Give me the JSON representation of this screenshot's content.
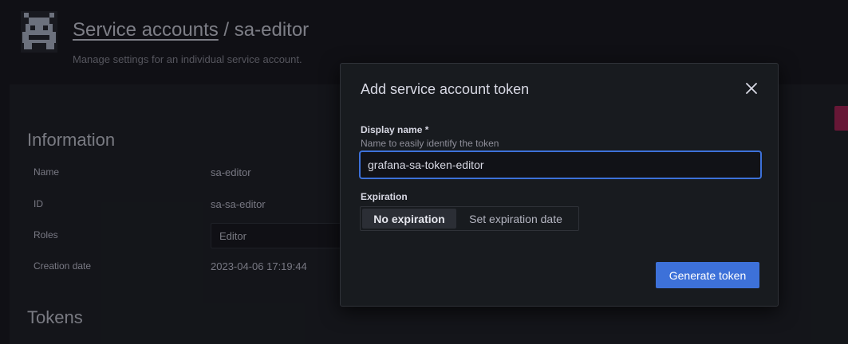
{
  "header": {
    "breadcrumb_link": "Service accounts",
    "separator": " / ",
    "title": "sa-editor",
    "subtitle": "Manage settings for an individual service account."
  },
  "information": {
    "heading": "Information",
    "rows": [
      {
        "label": "Name",
        "value": "sa-editor"
      },
      {
        "label": "ID",
        "value": "sa-sa-editor"
      },
      {
        "label": "Roles",
        "value": "Editor"
      },
      {
        "label": "Creation date",
        "value": "2023-04-06 17:19:44"
      }
    ]
  },
  "tokens": {
    "heading": "Tokens"
  },
  "modal": {
    "title": "Add service account token",
    "display_name": {
      "label": "Display name *",
      "description": "Name to easily identify the token",
      "value": "grafana-sa-token-editor"
    },
    "expiration": {
      "label": "Expiration",
      "options": [
        "No expiration",
        "Set expiration date"
      ],
      "selected": "No expiration"
    },
    "submit_label": "Generate token"
  },
  "colors": {
    "accent": "#3d71d9",
    "danger": "#b01e52",
    "background": "#111217",
    "panel": "#181b1f"
  }
}
